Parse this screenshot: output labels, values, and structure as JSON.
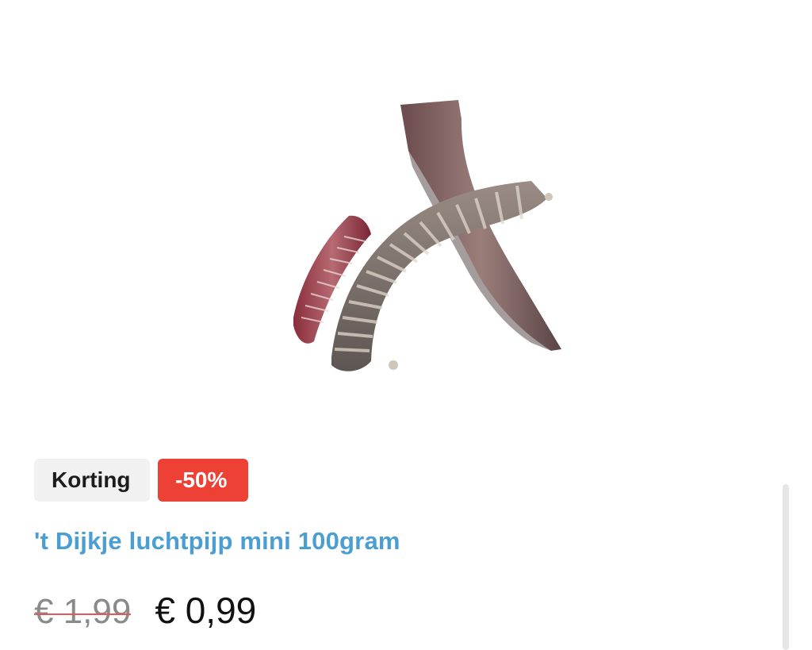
{
  "product": {
    "image_alt": "luchtpijp mini",
    "badges": {
      "discount_label": "Korting",
      "percent_label": "-50%"
    },
    "title": "'t Dijkje luchtpijp mini 100gram",
    "price_old": "€ 1,99",
    "price_new": "€ 0,99"
  },
  "colors": {
    "title": "#4a9ed2",
    "percent_badge": "#ee4136",
    "discount_badge_bg": "#f1f1f1"
  }
}
